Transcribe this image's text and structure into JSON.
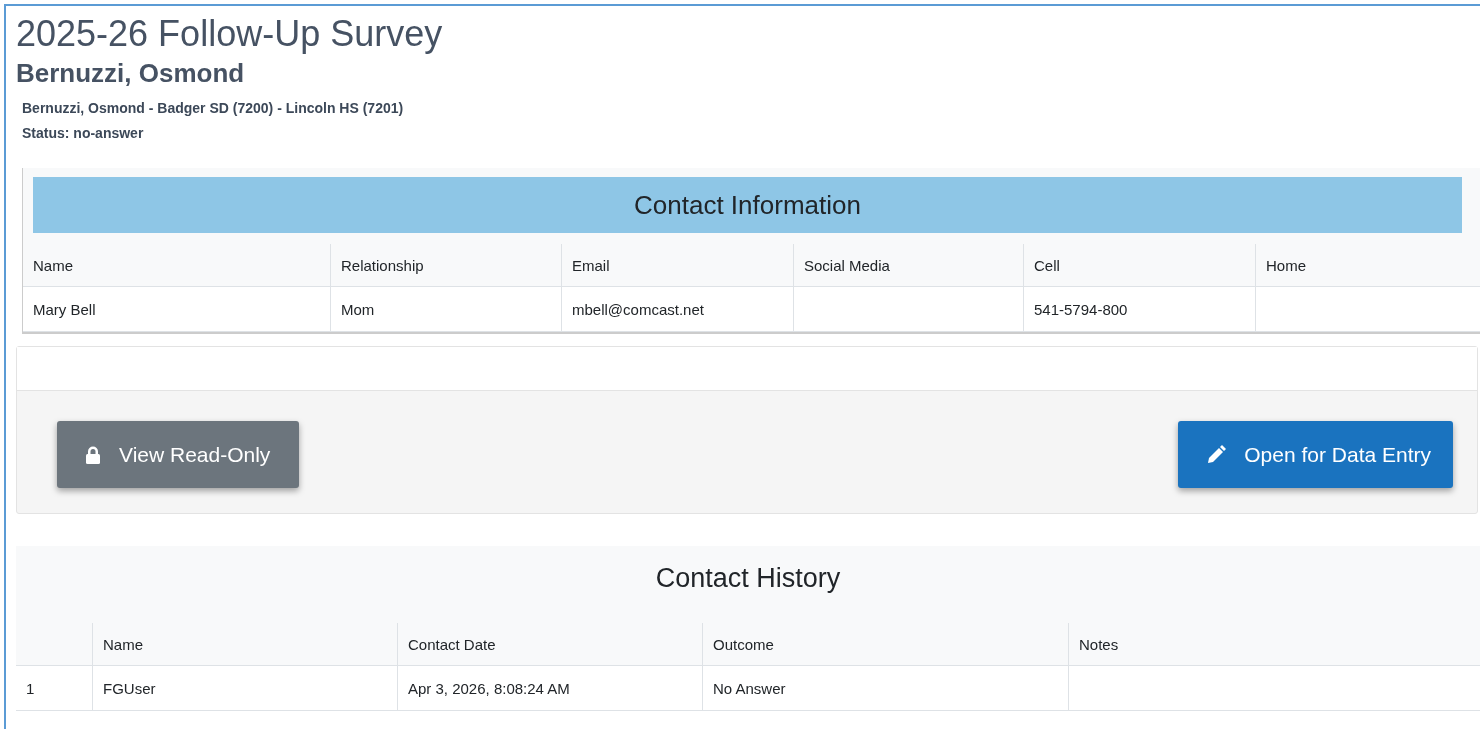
{
  "title": "2025-26 Follow-Up Survey",
  "person": "Bernuzzi, Osmond",
  "details": [
    "Bernuzzi, Osmond - Badger SD (7200) - Lincoln HS (7201)",
    "Status: no-answer"
  ],
  "contact_information": {
    "title": "Contact Information",
    "columns": [
      "Name",
      "Relationship",
      "Email",
      "Social Media",
      "Cell",
      "Home"
    ],
    "rows": [
      [
        "Mary Bell",
        "Mom",
        "mbell@comcast.net",
        "",
        "541-5794-800",
        ""
      ]
    ]
  },
  "actions": [
    {
      "label": "View Read-Only",
      "kind": "lock"
    },
    {
      "label": "Open for Data Entry",
      "kind": "edit"
    }
  ],
  "contact_history": {
    "title": "Contact History",
    "columns": [
      "",
      "Name",
      "Contact Date",
      "Outcome",
      "Notes"
    ],
    "rows": [
      [
        "1",
        "FGUser",
        "Apr 3, 2026, 8:08:24 AM",
        "No Answer",
        ""
      ]
    ]
  }
}
